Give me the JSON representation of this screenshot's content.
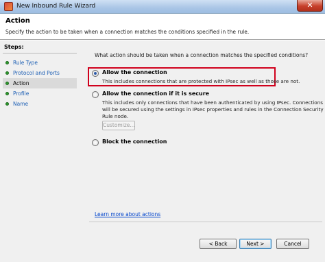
{
  "window": {
    "title": "New Inbound Rule Wizard",
    "close_glyph": "✕"
  },
  "header": {
    "title": "Action",
    "description": "Specify the action to be taken when a connection matches the conditions specified in the rule."
  },
  "steps": {
    "title": "Steps:",
    "items": [
      {
        "label": "Rule Type",
        "current": false
      },
      {
        "label": "Protocol and Ports",
        "current": false
      },
      {
        "label": "Action",
        "current": true
      },
      {
        "label": "Profile",
        "current": false
      },
      {
        "label": "Name",
        "current": false
      }
    ]
  },
  "main": {
    "question": "What action should be taken when a connection matches the specified conditions?",
    "options": [
      {
        "label": "Allow the connection",
        "description": "This includes connections that are protected with IPsec as well as those are not.",
        "selected": true
      },
      {
        "label": "Allow the connection if it is secure",
        "description_lines": [
          "This includes only connections that have been authenticated by using IPsec.  Connections",
          "will be secured using the settings in IPsec properties and rules in the Connection Security",
          "Rule node."
        ],
        "selected": false
      },
      {
        "label": "Block the connection",
        "selected": false
      }
    ],
    "customize_label": "Customize...",
    "learn_more": "Learn more about actions"
  },
  "footer": {
    "back_label": "< Back",
    "next_label": "Next >",
    "cancel_label": "Cancel"
  },
  "colors": {
    "highlight": "#d0001c",
    "link": "#0044cc",
    "step_dot": "#2e9b2e"
  }
}
